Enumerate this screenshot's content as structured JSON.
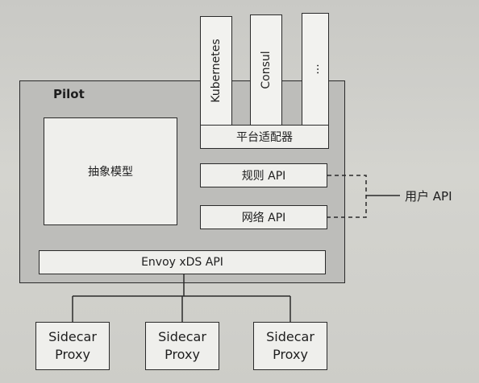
{
  "diagram": {
    "pilot_label": "Pilot",
    "platforms": [
      "Kubernetes",
      "Consul",
      "..."
    ],
    "platform_adapter": "平台适配器",
    "abstract_model": "抽象模型",
    "rules_api": "规则 API",
    "network_api": "网络 API",
    "envoy_api": "Envoy xDS API",
    "user_api": "用户 API",
    "proxies": [
      {
        "line1": "Sidecar",
        "line2": "Proxy"
      },
      {
        "line1": "Sidecar",
        "line2": "Proxy"
      },
      {
        "line1": "Sidecar",
        "line2": "Proxy"
      }
    ]
  }
}
